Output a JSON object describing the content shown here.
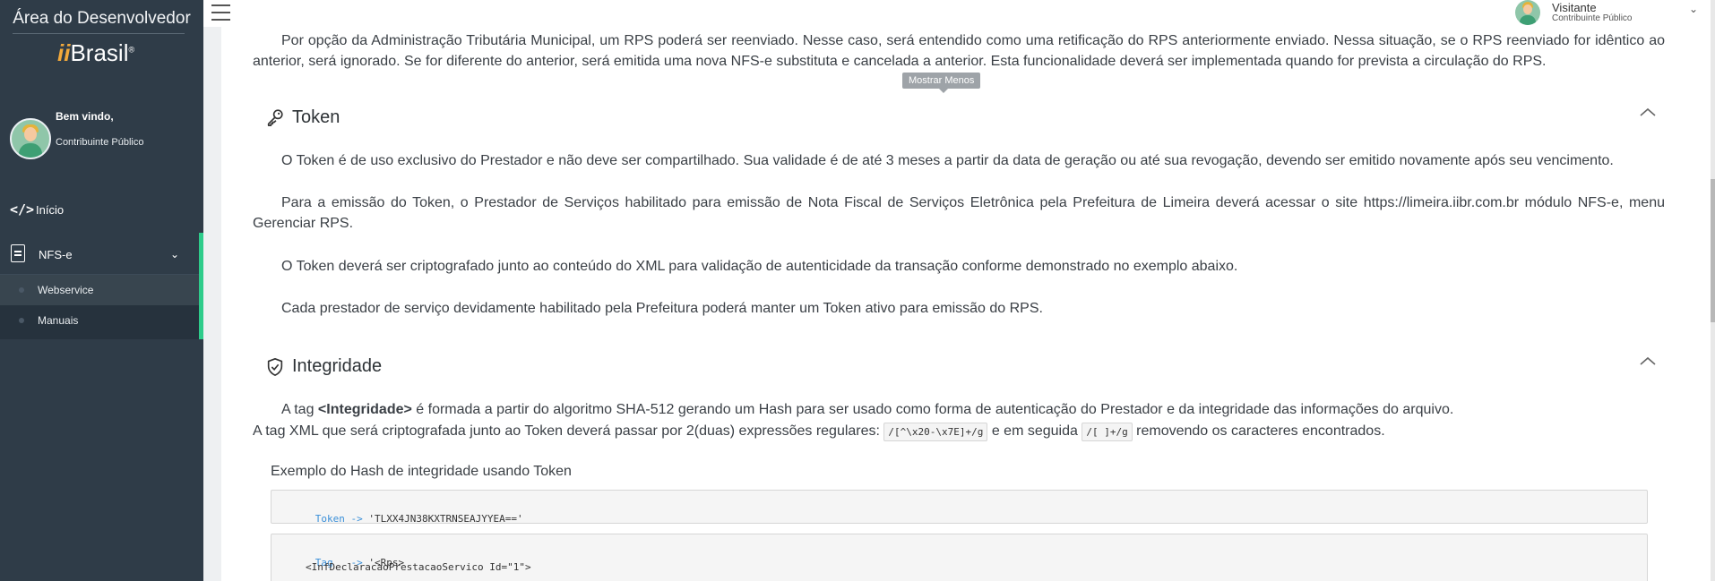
{
  "sidebar": {
    "title": "Área do Desenvolvedor",
    "logo_prefix": "ii",
    "logo_text": "Brasil",
    "logo_mark": "®",
    "welcome_line1": "Bem vindo,",
    "welcome_line2": "Contribuinte Público",
    "nav": {
      "inicio_label": "Início",
      "inicio_icon": "</>",
      "nfse_label": "NFS-e",
      "nfse_chevron": "⌄",
      "sub_items": [
        "Webservice",
        "Manuais"
      ]
    },
    "colors": {
      "background": "#2f3c48",
      "active_accent": "#2ecc8b"
    }
  },
  "header": {
    "user_name": "Visitante",
    "user_role": "Contribuinte Público",
    "chevron": "⌄"
  },
  "tooltip": "Mostrar Menos",
  "content": {
    "intro_paragraph": "Por opção da Administração Tributária Municipal, um RPS poderá ser reenviado. Nesse caso, será entendido como uma retificação do RPS anteriormente enviado. Nessa situação, se o RPS reenviado for idêntico ao anterior, será ignorado. Se for diferente do anterior, será emitida uma nova NFS-e substituta e cancelada a anterior. Esta funcionalidade deverá ser implementada quando for prevista a circulação do RPS.",
    "token": {
      "title": "Token",
      "paragraphs": [
        "O Token é de uso exclusivo do Prestador e não deve ser compartilhado. Sua validade é de até 3 meses a partir da data de geração ou até sua revogação, devendo ser emitido novamente após seu vencimento.",
        "Para a emissão do Token, o Prestador de Serviços habilitado para emissão de Nota Fiscal de Serviços Eletrônica pela Prefeitura de Limeira deverá acessar o site https://limeira.iibr.com.br módulo NFS-e, menu Gerenciar RPS.",
        "O Token deverá ser criptografado junto ao conteúdo do XML para validação de autenticidade da transação conforme demonstrado no exemplo abaixo.",
        "Cada prestador de serviço devidamente habilitado pela Prefeitura poderá manter um Token ativo para emissão do RPS."
      ]
    },
    "integridade": {
      "title": "Integridade",
      "p1_prefix": "A tag ",
      "p1_tag": "<Integridade>",
      "p1_suffix": " é formada a partir do algoritmo SHA-512 gerando um Hash para ser usado como forma de autenticação do Prestador e da integridade das informações do arquivo.",
      "p2_prefix": "A tag XML que será criptografada junto ao Token deverá passar por 2(duas) expressões regulares: ",
      "regex1": "/[^\\x20-\\x7E]+/g",
      "p2_middle": " e em seguida ",
      "regex2": "/[ ]+/g",
      "p2_suffix": " removendo os caracteres encontrados.",
      "example_title": "Exemplo do Hash de integridade usando Token",
      "code1_key": "Token",
      "code1_arrow": "->",
      "code1_value": "'TLXX4JN38KXTRNSEAJYYEA=='",
      "code2_key": "Tag",
      "code2_arrow": "->",
      "code2_line1": "'<Rps>",
      "code2_line2": "<InfDeclaracaoPrestacaoServico Id=\"1\">"
    }
  }
}
